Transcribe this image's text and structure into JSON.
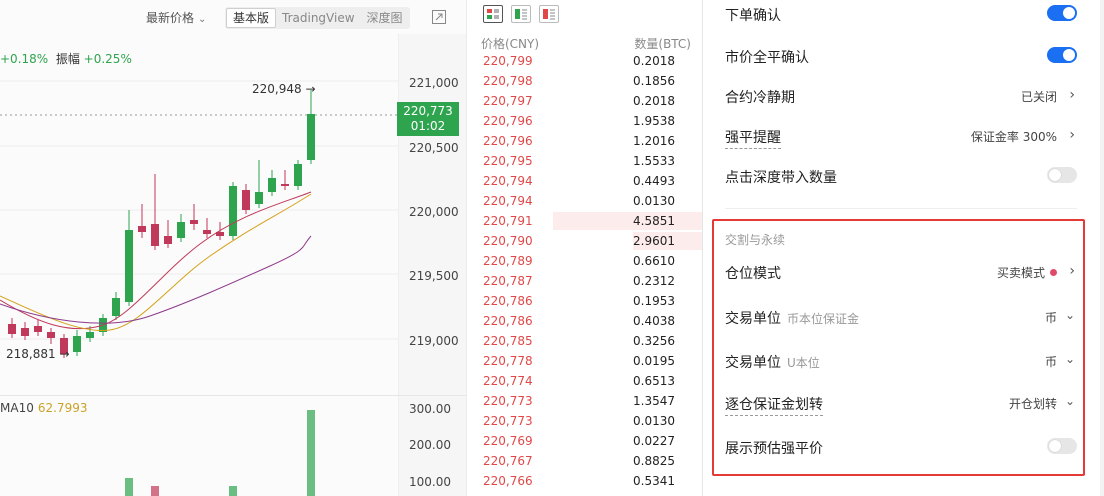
{
  "chart": {
    "price_type": "最新价格",
    "views": [
      "基本版",
      "TradingView",
      "深度图"
    ],
    "active_view": "基本版",
    "change_label": "+0.18%",
    "amplitude_label": "振幅",
    "amplitude_value": "+0.25%",
    "price_axis": [
      "221,000",
      "220,500",
      "220,000",
      "219,500",
      "219,000"
    ],
    "volume_axis": [
      "300.00",
      "200.00",
      "100.00"
    ],
    "current_price": "220,773",
    "countdown": "01:02",
    "high_label": "220,948",
    "low_label": "218,881",
    "ma_label": "MA10",
    "ma_value": "62.7993",
    "up_color": "#2ea44f",
    "down_color": "#c0395a"
  },
  "order_book": {
    "header_price": "价格(CNY)",
    "header_amount": "数量(BTC)",
    "rows": [
      {
        "price": "220,799",
        "qty": "0.2018"
      },
      {
        "price": "220,798",
        "qty": "0.1856"
      },
      {
        "price": "220,797",
        "qty": "0.2018"
      },
      {
        "price": "220,796",
        "qty": "1.9538"
      },
      {
        "price": "220,796",
        "qty": "1.2016"
      },
      {
        "price": "220,795",
        "qty": "1.5533"
      },
      {
        "price": "220,794",
        "qty": "0.4493"
      },
      {
        "price": "220,794",
        "qty": "0.0130"
      },
      {
        "price": "220,791",
        "qty": "4.5851"
      },
      {
        "price": "220,790",
        "qty": "2.9601"
      },
      {
        "price": "220,789",
        "qty": "0.6610"
      },
      {
        "price": "220,787",
        "qty": "0.2312"
      },
      {
        "price": "220,786",
        "qty": "0.1953"
      },
      {
        "price": "220,786",
        "qty": "0.4038"
      },
      {
        "price": "220,785",
        "qty": "0.3256"
      },
      {
        "price": "220,778",
        "qty": "0.0195"
      },
      {
        "price": "220,774",
        "qty": "0.6513"
      },
      {
        "price": "220,773",
        "qty": "1.3547"
      },
      {
        "price": "220,773",
        "qty": "0.0130"
      },
      {
        "price": "220,769",
        "qty": "0.0227"
      },
      {
        "price": "220,767",
        "qty": "0.8825"
      },
      {
        "price": "220,766",
        "qty": "0.5341"
      }
    ],
    "ask_color": "#e04848"
  },
  "settings": {
    "order_confirm": {
      "label": "下单确认",
      "enabled": true
    },
    "market_close_confirm": {
      "label": "市价全平确认",
      "enabled": true
    },
    "cooldown": {
      "label": "合约冷静期",
      "value": "已关闭"
    },
    "liquidation_alert": {
      "label": "强平提醒",
      "value": "保证金率 300%"
    },
    "depth_click": {
      "label": "点击深度带入数量",
      "enabled": false
    },
    "section_title": "交割与永续",
    "position_mode": {
      "label": "仓位模式",
      "value": "买卖模式"
    },
    "unit_coin": {
      "label": "交易单位",
      "sublabel": "币本位保证金",
      "value": "币"
    },
    "unit_usdt": {
      "label": "交易单位",
      "sublabel": "U本位",
      "value": "币"
    },
    "isolated_transfer": {
      "label": "逐仓保证金划转",
      "value": "开仓划转"
    },
    "show_liq_price": {
      "label": "展示预估强平价",
      "enabled": false
    },
    "toggle_on_color": "#1a6ff2",
    "highlight_color": "#e53935"
  }
}
